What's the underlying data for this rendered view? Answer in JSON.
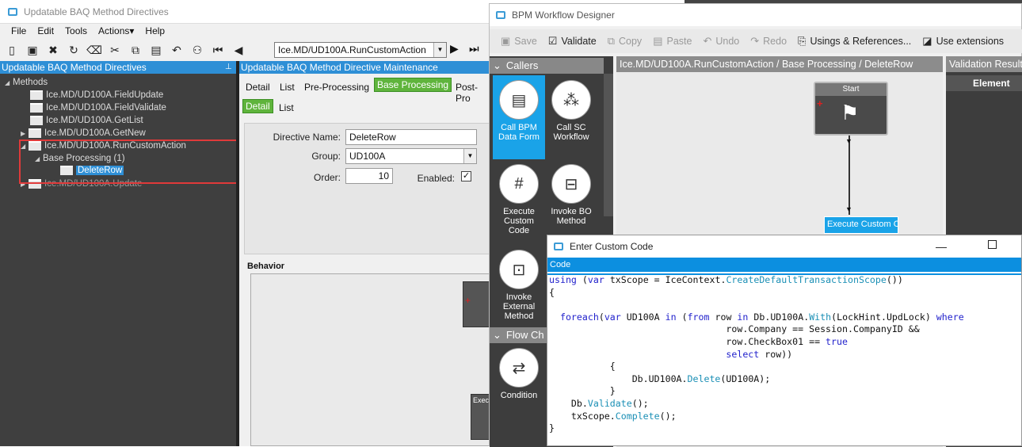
{
  "win_left": {
    "title": "Updatable BAQ Method Directives",
    "menu": [
      "File",
      "Edit",
      "Tools",
      "Actions▾",
      "Help"
    ],
    "combo_value": "Ice.MD/UD100A.RunCustomAction",
    "left_panel_title": "Updatable BAQ Method Directives",
    "tree": {
      "root": "Methods",
      "items": [
        "Ice.MD/UD100A.FieldUpdate",
        "Ice.MD/UD100A.FieldValidate",
        "Ice.MD/UD100A.GetList",
        "Ice.MD/UD100A.GetNew",
        "Ice.MD/UD100A.RunCustomAction"
      ],
      "base_processing": "Base Processing (1)",
      "selected": "DeleteRow",
      "last": "Ice.MD/UD100A.Update"
    },
    "right_panel_title": "Updatable BAQ Method Directive Maintenance",
    "tabs": [
      "Detail",
      "List",
      "Pre-Processing",
      "Base Processing",
      "Post-Pro"
    ],
    "subtabs": [
      "Detail",
      "List"
    ],
    "form": {
      "directive_name_label": "Directive Name:",
      "directive_name": "DeleteRow",
      "group_label": "Group:",
      "group": "UD100A",
      "order_label": "Order:",
      "order": "10",
      "enabled_label": "Enabled:",
      "enabled_mark": "✓"
    },
    "behavior_label": "Behavior",
    "behavior_node_label": "Execu"
  },
  "win_bpm": {
    "title": "BPM Workflow Designer",
    "toolbar": [
      "Save",
      "Validate",
      "Copy",
      "Paste",
      "Undo",
      "Redo",
      "Usings & References...",
      "Use extensions"
    ],
    "callers_label": "Callers",
    "palette": [
      "Call BPM Data Form",
      "Call SC Workflow",
      "Execute Custom Code",
      "Invoke BO Method",
      "Invoke External Method"
    ],
    "flow_label": "Flow Ch",
    "condition_label": "Condition",
    "breadcrumb": "Ice.MD/UD100A.RunCustomAction / Base Processing / DeleteRow",
    "start_label": "Start",
    "exec_label": "Execute Custom Co",
    "validation_title": "Validation Results",
    "element_col": "Element"
  },
  "win_code": {
    "title": "Enter Custom Code",
    "code_tab": "Code",
    "lines": [
      "using (var txScope = IceContext.CreateDefaultTransactionScope())",
      "{",
      "",
      "  foreach(var UD100A in (from row in Db.UD100A.With(LockHint.UpdLock) where",
      "                                row.Company == Session.CompanyID &&",
      "                                row.CheckBox01 == true",
      "                                select row))",
      "           {",
      "               Db.UD100A.Delete(UD100A);",
      "           }",
      "    Db.Validate();",
      "    txScope.Complete();",
      "}"
    ]
  }
}
